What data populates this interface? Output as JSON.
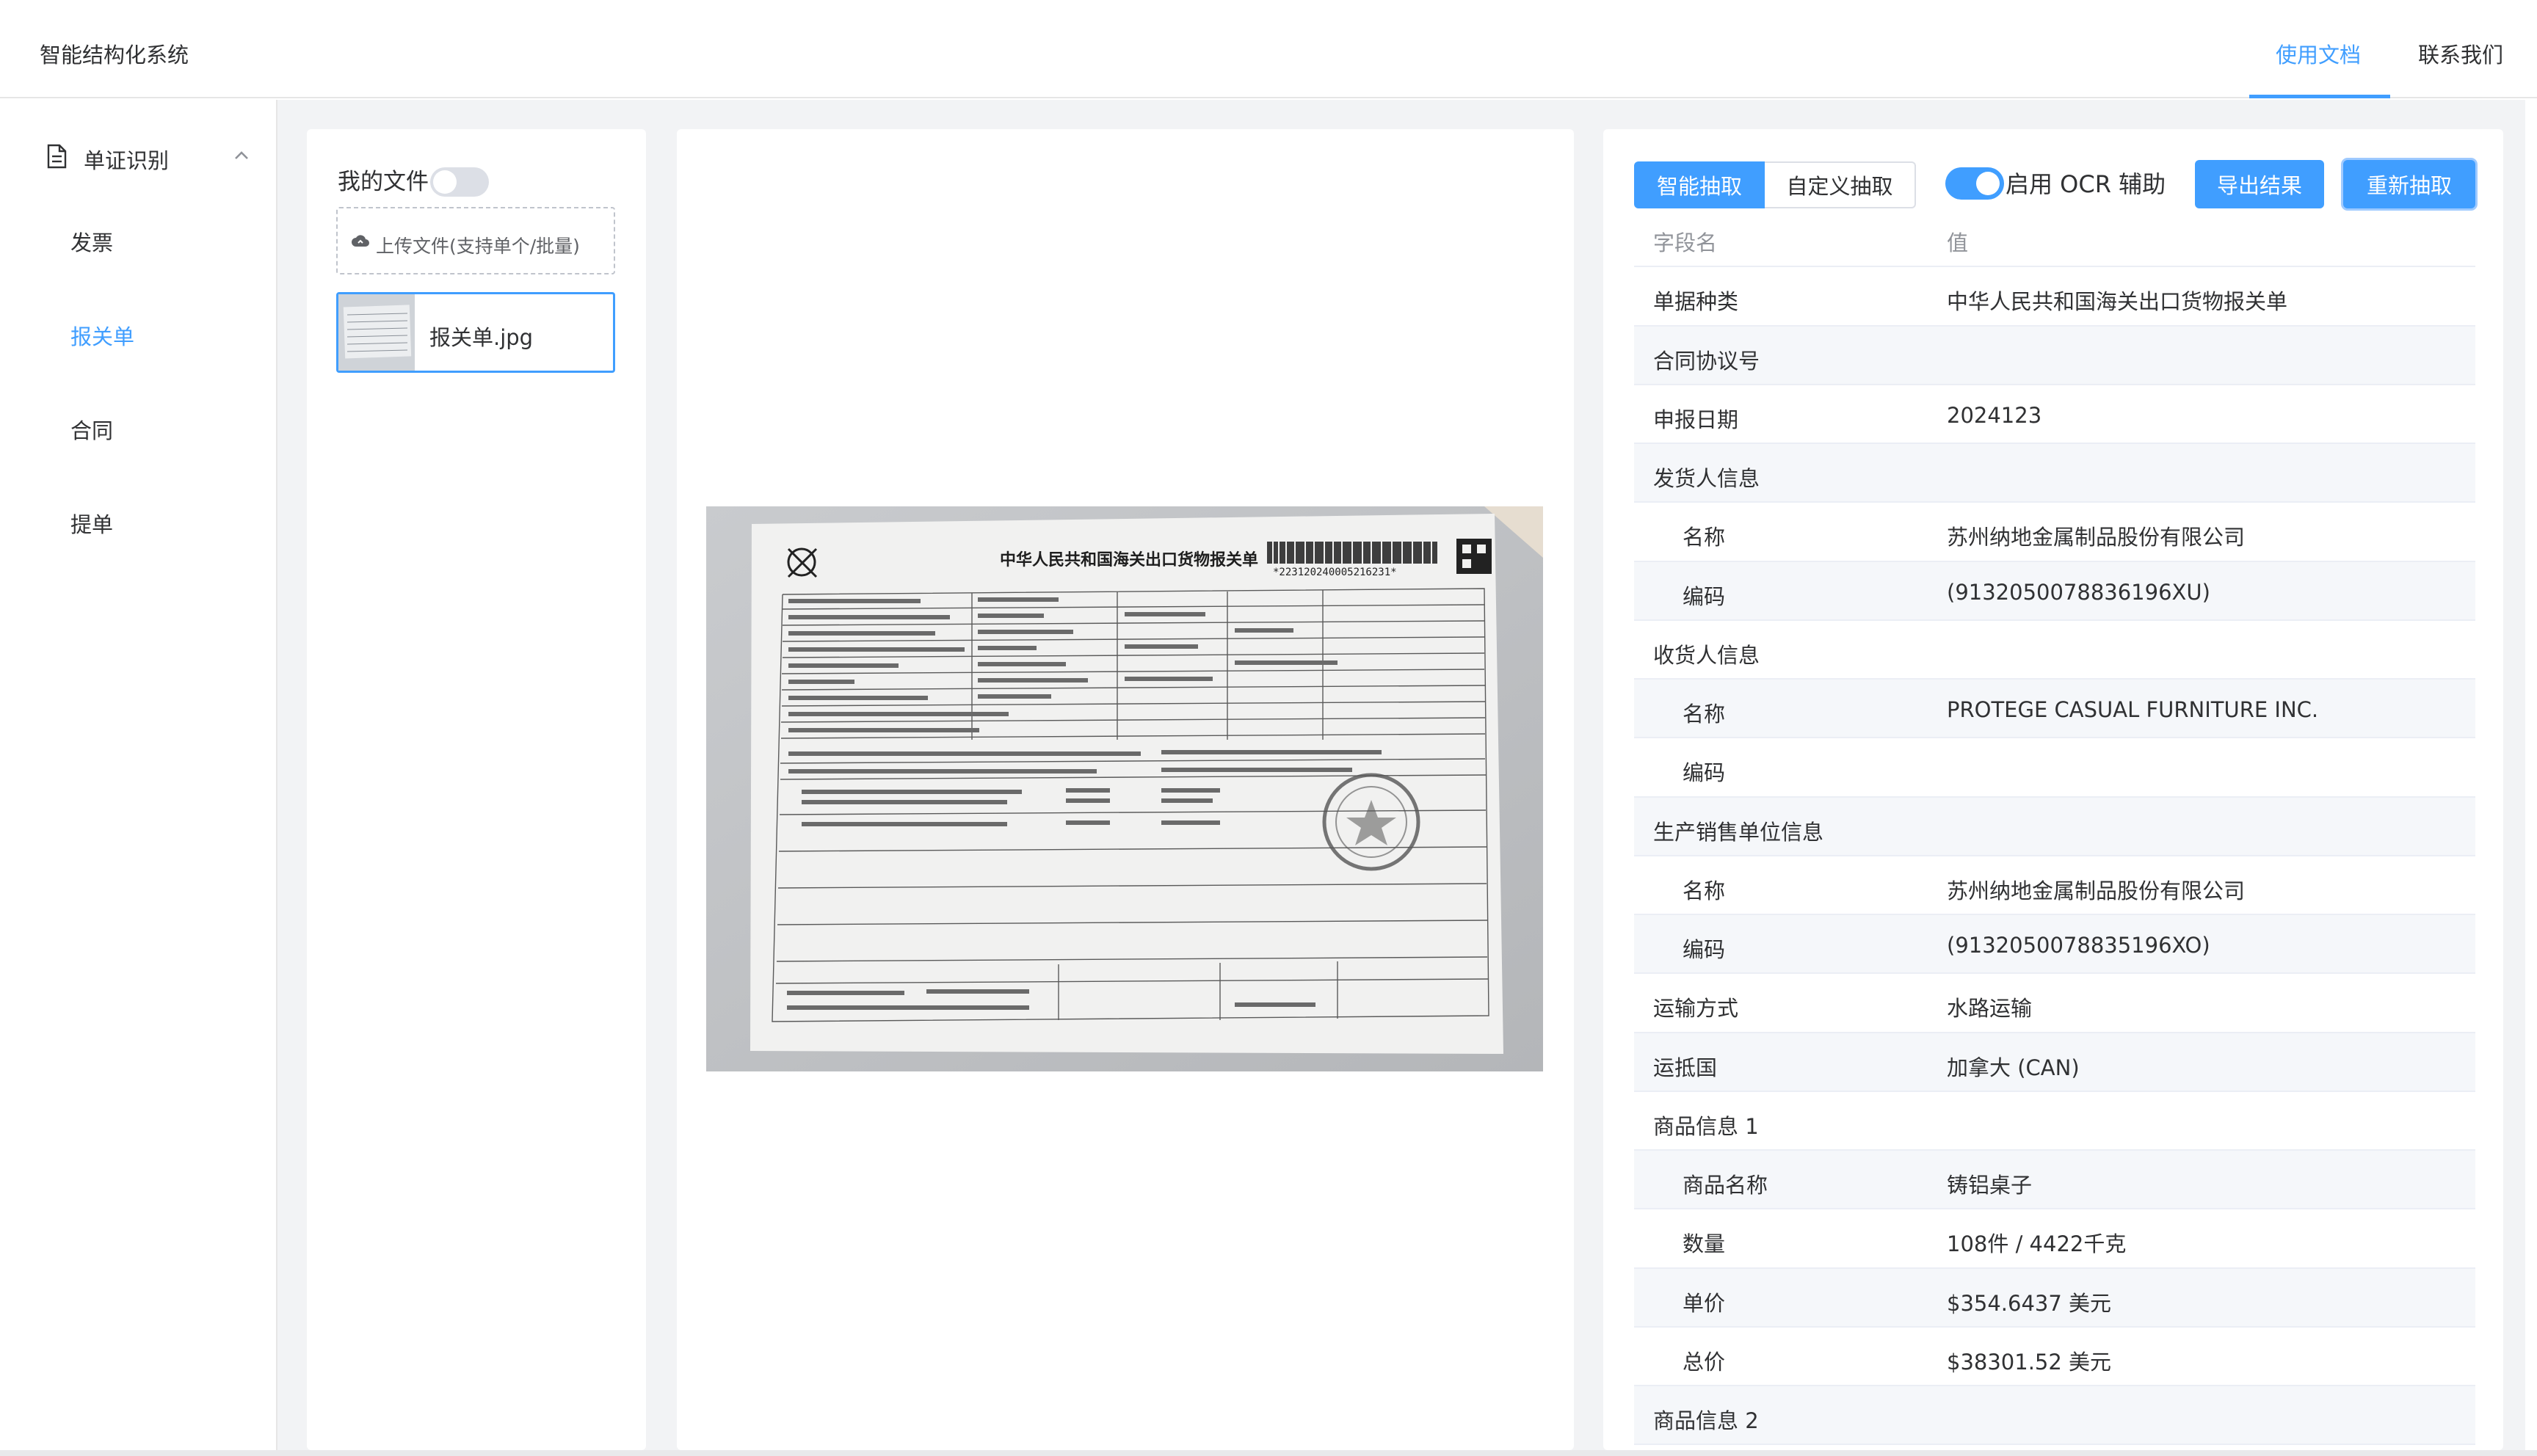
{
  "app": {
    "title": "智能结构化系统"
  },
  "top_nav": {
    "docs": "使用文档",
    "contact": "联系我们"
  },
  "sidebar": {
    "group_label": "单证识别",
    "items": [
      {
        "label": "发票"
      },
      {
        "label": "报关单"
      },
      {
        "label": "合同"
      },
      {
        "label": "提单"
      }
    ]
  },
  "files": {
    "title": "我的文件",
    "upload_label": "上传文件(支持单个/批量)",
    "items": [
      {
        "name": "报关单.jpg"
      }
    ]
  },
  "preview": {
    "doc_title": "中华人民共和国海关出口货物报关单",
    "doc_number": "*223120240005216231*"
  },
  "result": {
    "tabs": [
      "智能抽取",
      "自定义抽取"
    ],
    "ocr_label": "启用 OCR 辅助",
    "export_label": "导出结果",
    "reextract_label": "重新抽取",
    "header": {
      "field": "字段名",
      "value": "值"
    },
    "rows": [
      {
        "k": "单据种类",
        "v": "中华人民共和国海关出口货物报关单"
      },
      {
        "k": "合同协议号",
        "v": ""
      },
      {
        "k": "申报日期",
        "v": "2024123"
      },
      {
        "k": "发货人信息",
        "v": ""
      },
      {
        "k": "名称",
        "v": "苏州纳地金属制品股份有限公司"
      },
      {
        "k": "编码",
        "v": "(9132050078836196XU)"
      },
      {
        "k": "收货人信息",
        "v": ""
      },
      {
        "k": "名称",
        "v": "PROTEGE CASUAL FURNITURE INC."
      },
      {
        "k": "编码",
        "v": ""
      },
      {
        "k": "生产销售单位信息",
        "v": ""
      },
      {
        "k": "名称",
        "v": "苏州纳地金属制品股份有限公司"
      },
      {
        "k": "编码",
        "v": "(9132050078835196XO)"
      },
      {
        "k": "运输方式",
        "v": "水路运输"
      },
      {
        "k": "运抵国",
        "v": "加拿大 (CAN)"
      },
      {
        "k": "商品信息 1",
        "v": ""
      },
      {
        "k": "商品名称",
        "v": "铸铝桌子"
      },
      {
        "k": "数量",
        "v": "108件 / 4422千克"
      },
      {
        "k": "单价",
        "v": "$354.6437 美元"
      },
      {
        "k": "总价",
        "v": "$38301.52 美元"
      },
      {
        "k": "商品信息 2",
        "v": ""
      }
    ]
  },
  "colors": {
    "accent": "#409eff",
    "bg": "#f2f3f5",
    "text": "#303133"
  }
}
